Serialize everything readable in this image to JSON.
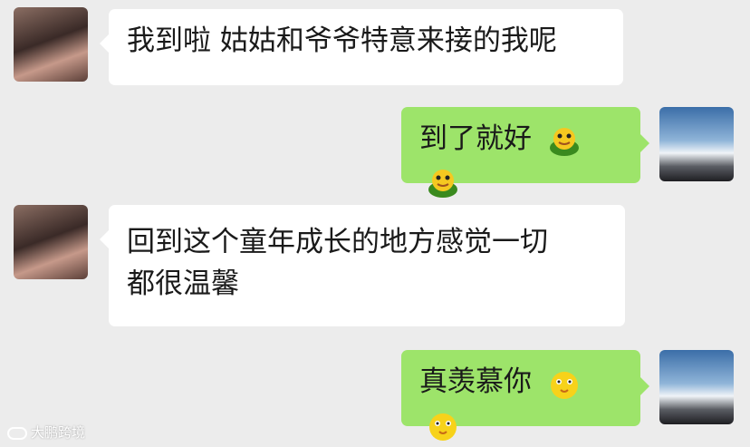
{
  "messages": [
    {
      "side": "left",
      "text": "我到啦  姑姑和爷爷特意来接的我呢"
    },
    {
      "side": "right",
      "text": "到了就好",
      "emoji": "frog-emoji"
    },
    {
      "side": "left",
      "line1": "回到这个童年成长的地方感觉一切",
      "line2": "都很温馨"
    },
    {
      "side": "right",
      "text": "真羡慕你",
      "emoji": "chick-emoji"
    }
  ],
  "watermark": "大鹏跨境",
  "colors": {
    "outgoing_bubble": "#9de46a",
    "incoming_bubble": "#ffffff",
    "background": "#ececec"
  }
}
